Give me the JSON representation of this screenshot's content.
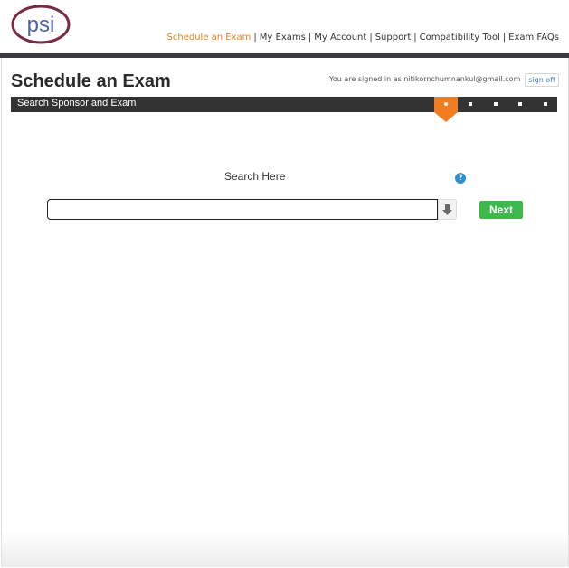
{
  "logo": {
    "text": "psi"
  },
  "nav": {
    "items": [
      {
        "label": "Schedule an Exam",
        "active": true
      },
      {
        "label": "My Exams",
        "active": false
      },
      {
        "label": "My Account",
        "active": false
      },
      {
        "label": "Support",
        "active": false
      },
      {
        "label": "Compatibility Tool",
        "active": false
      },
      {
        "label": "Exam FAQs",
        "active": false
      }
    ],
    "separator": "|"
  },
  "page": {
    "title": "Schedule an Exam",
    "signed_in_text": "You are signed in as nitikornchumnankul@gmail.com",
    "sign_off_label": "sign off"
  },
  "steps": {
    "current_label": "Search Sponsor and Exam",
    "total": 5,
    "current_index": 1
  },
  "search": {
    "label": "Search Here",
    "help_symbol": "?",
    "value": "",
    "next_label": "Next"
  },
  "colors": {
    "accent": "#f07d1f",
    "nav_active": "#e8821e",
    "next_button": "#3cb94a",
    "bar": "#333333",
    "logo_ring": "#7a2a45",
    "logo_text": "#4f63a8"
  },
  "icons": {
    "dropdown": "arrow-down-icon",
    "help": "help-icon"
  }
}
